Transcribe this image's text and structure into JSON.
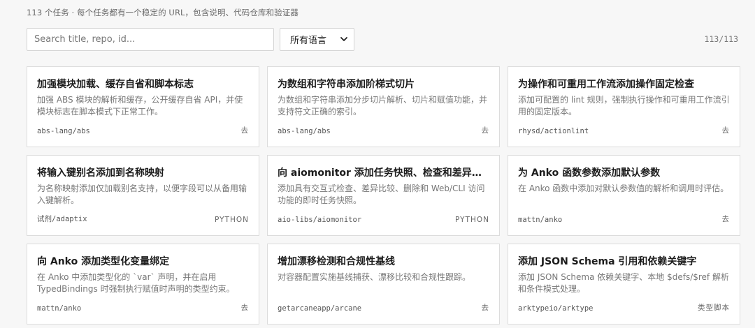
{
  "header": {
    "subtitle": "113 个任务 · 每个任务都有一个稳定的 URL，包含说明、代码仓库和验证器"
  },
  "search": {
    "placeholder": "Search title, repo, id...",
    "value": ""
  },
  "language_filter": {
    "selected": "所有语言"
  },
  "result_count": "113/113",
  "tasks": [
    {
      "title": "加强模块加载、缓存自省和脚本标志",
      "description": "加强 ABS 模块的解析和缓存，公开缓存自省 API，并使模块标志在脚本模式下正常工作。",
      "repo": "abs-lang/abs",
      "tag": "去"
    },
    {
      "title": "为数组和字符串添加阶梯式切片",
      "description": "为数组和字符串添加分步切片解析、切片和赋值功能，并支持符文正确的索引。",
      "repo": "abs-lang/abs",
      "tag": "去"
    },
    {
      "title": "为操作和可重用工作流添加操作固定检查",
      "description": "添加可配置的 lint 规则，强制执行操作和可重用工作流引用的固定版本。",
      "repo": "rhysd/actionlint",
      "tag": "去"
    },
    {
      "title": "将输入键别名添加到名称映射",
      "description": "为名称映射添加仅加载别名支持，以便字段可以从备用输入键解析。",
      "repo": "试剂/adaptix",
      "tag": "PYTHON"
    },
    {
      "title": "向 aiomonitor 添加任务快照、检查和差异比较功能",
      "description": "添加具有交互式检查、差异比较、删除和 Web/CLI 访问功能的即时任务快照。",
      "repo": "aio-libs/aiomonitor",
      "tag": "PYTHON"
    },
    {
      "title": "为 Anko 函数参数添加默认参数",
      "description": "在 Anko 函数中添加对默认参数值的解析和调用时评估。",
      "repo": "mattn/anko",
      "tag": "去"
    },
    {
      "title": "向 Anko 添加类型化变量绑定",
      "description": "在 Anko 中添加类型化的 `var` 声明，并在启用 TypedBindings 时强制执行赋值时声明的类型约束。",
      "repo": "mattn/anko",
      "tag": "去"
    },
    {
      "title": "增加漂移检测和合规性基线",
      "description": "对容器配置实施基线捕获、漂移比较和合规性跟踪。",
      "repo": "getarcaneapp/arcane",
      "tag": "去"
    },
    {
      "title": "添加 JSON Schema 引用和依赖关键字",
      "description": "添加 JSON Schema 依赖关键字、本地 $defs/$ref 解析和条件模式处理。",
      "repo": "arktypeio/arktype",
      "tag": "类型脚本"
    }
  ]
}
